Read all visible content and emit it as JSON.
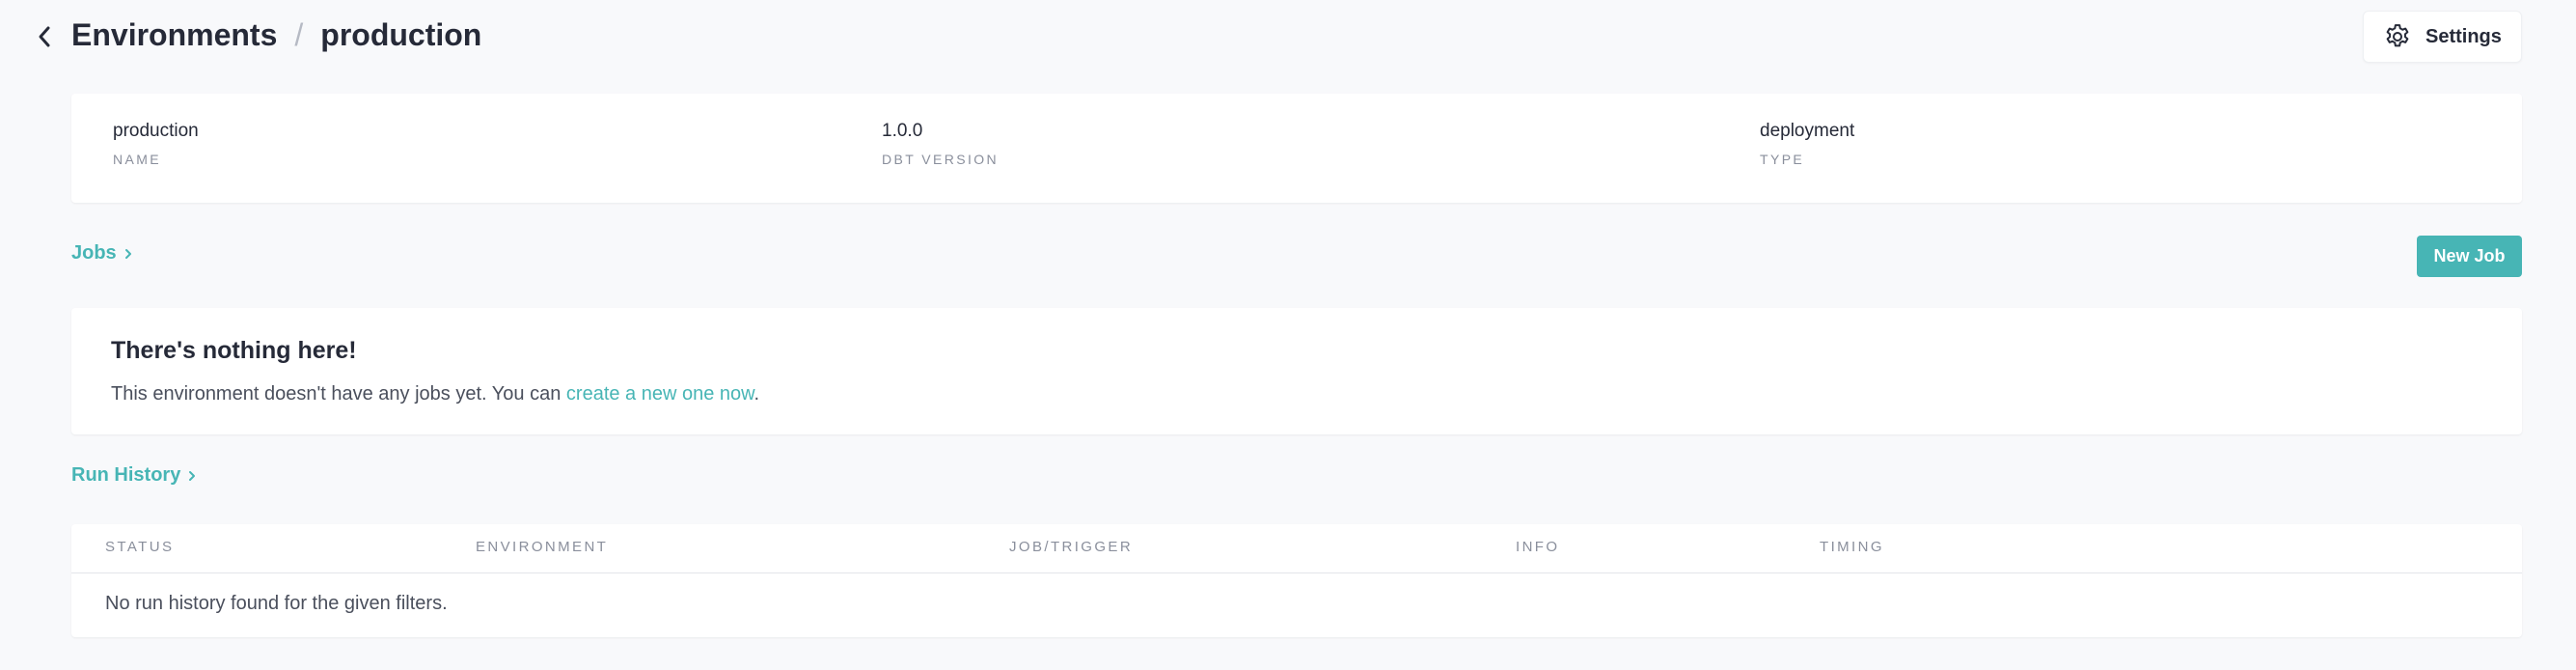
{
  "header": {
    "breadcrumb_parent": "Environments",
    "separator": "/",
    "breadcrumb_current": "production",
    "back_icon": "chevron-left-icon",
    "settings_label": "Settings",
    "settings_icon": "gear-icon"
  },
  "environment": {
    "fields": [
      {
        "value": "production",
        "label": "NAME"
      },
      {
        "value": "1.0.0",
        "label": "DBT VERSION"
      },
      {
        "value": "deployment",
        "label": "TYPE"
      }
    ]
  },
  "jobs": {
    "section_label": "Jobs",
    "new_job_label": "New Job",
    "empty_title": "There's nothing here!",
    "empty_text_before": "This environment doesn't have any jobs yet. You can ",
    "empty_link": "create a new one now",
    "empty_text_after": "."
  },
  "run_history": {
    "section_label": "Run History",
    "columns": [
      "STATUS",
      "ENVIRONMENT",
      "JOB/TRIGGER",
      "INFO",
      "TIMING"
    ],
    "empty_message": "No run history found for the given filters."
  },
  "colors": {
    "accent": "#47b5b5",
    "background": "#f8f9fb",
    "text": "#262a38",
    "muted": "#8a8f9c"
  }
}
